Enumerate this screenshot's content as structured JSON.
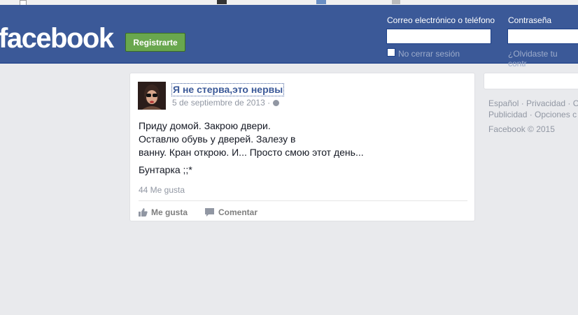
{
  "header": {
    "logo": "facebook",
    "signup_label": "Registrarte",
    "email_label": "Correo electrónico o teléfono",
    "password_label": "Contraseña",
    "remember_label": "No cerrar sesión",
    "forgot_label": "¿Olvidaste tu contr",
    "brand_color": "#3b5998",
    "signup_color": "#69a74e"
  },
  "post": {
    "author": "Я не стерва,это нервы",
    "date": "5 de septiembre de 2013 ·",
    "lines": [
      "Приду домой. Закрою двери.",
      "Оставлю обувь у дверей. Залезу в",
      "ванну. Кран открою. И... Просто смою этот день..."
    ],
    "signature": "Бунтарка ;;*",
    "likes": "44 Me gusta",
    "like_label": "Me gusta",
    "comment_label": "Comentar"
  },
  "sidebar": {
    "lang_line1": "Español · Privacidad · C",
    "lang_line2": "Publicidad · Opciones c",
    "copyright": "Facebook © 2015"
  }
}
